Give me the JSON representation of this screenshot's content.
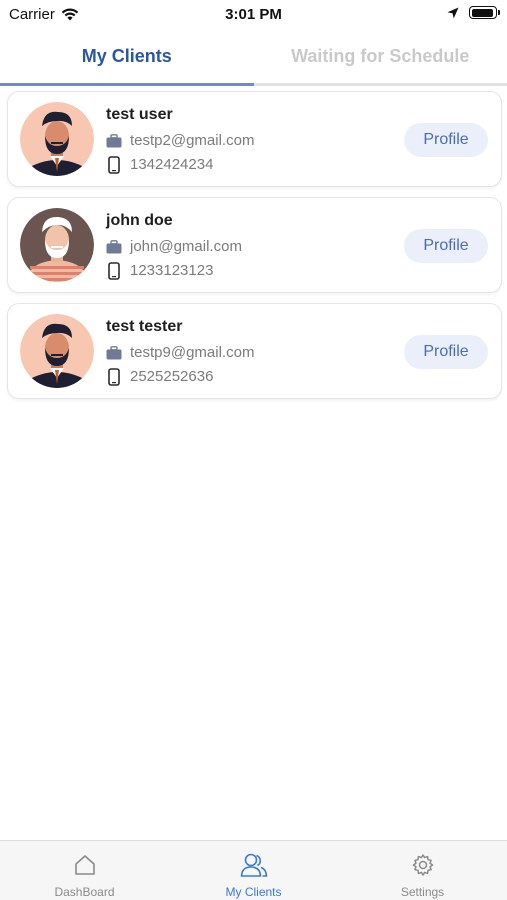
{
  "status_bar": {
    "carrier": "Carrier",
    "time": "3:01 PM",
    "battery_level": 0.92
  },
  "tabs": [
    {
      "label": "My Clients",
      "active": true
    },
    {
      "label": "Waiting for Schedule",
      "active": false
    }
  ],
  "clients": [
    {
      "name": "test user",
      "email": "testp2@gmail.com",
      "phone": "1342424234",
      "button_label": "Profile",
      "avatar": "bearded-man-avatar"
    },
    {
      "name": "john doe",
      "email": "john@gmail.com",
      "phone": "1233123123",
      "button_label": "Profile",
      "avatar": "old-man-avatar"
    },
    {
      "name": "test tester",
      "email": "testp9@gmail.com",
      "phone": "2525252636",
      "button_label": "Profile",
      "avatar": "bearded-man-avatar"
    }
  ],
  "bottom_nav": [
    {
      "label": "DashBoard",
      "icon": "home-icon",
      "active": false
    },
    {
      "label": "My Clients",
      "icon": "users-icon",
      "active": true
    },
    {
      "label": "Settings",
      "icon": "gear-icon",
      "active": false
    }
  ],
  "colors": {
    "accent": "#2a56a6",
    "nav_active": "#3a78d6",
    "button_bg": "#eaeff9",
    "button_text": "#4a6db3"
  }
}
